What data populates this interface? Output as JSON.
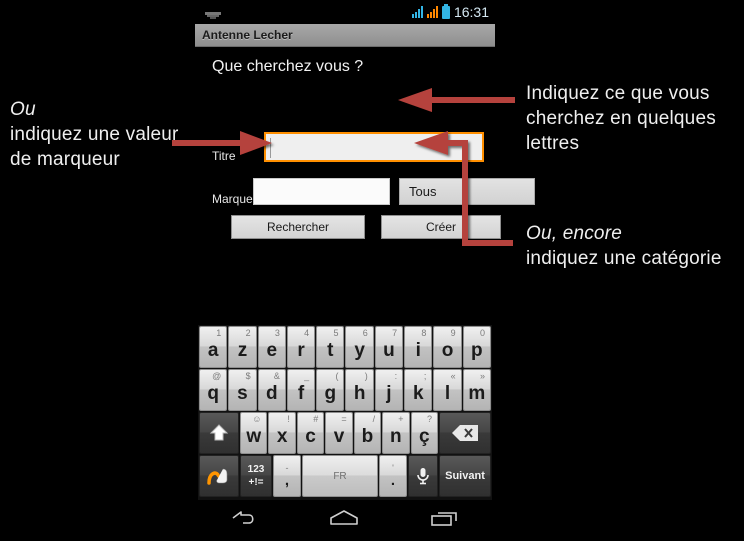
{
  "annotations": {
    "left": {
      "italic": "Ou",
      "rest": "indiquez une valeur de marqueur"
    },
    "top_right": {
      "text": "Indiquez ce que vous cherchez en quelques lettres"
    },
    "bottom_right": {
      "italic": "Ou, encore",
      "rest": "indiquez une catégorie"
    }
  },
  "statusbar": {
    "time": "16:31"
  },
  "titlebar": {
    "title": "Antenne Lecher"
  },
  "form": {
    "heading": "Que cherchez vous ?",
    "label_titre": "Titre",
    "value_titre": "",
    "label_marqueur": "Marqueur",
    "value_marqueur": "",
    "spinner_value": "Tous",
    "button_rechercher": "Rechercher",
    "button_creer": "Créer"
  },
  "keyboard": {
    "row1": [
      {
        "key": "a",
        "hint": "1"
      },
      {
        "key": "z",
        "hint": "2"
      },
      {
        "key": "e",
        "hint": "3"
      },
      {
        "key": "r",
        "hint": "4"
      },
      {
        "key": "t",
        "hint": "5"
      },
      {
        "key": "y",
        "hint": "6"
      },
      {
        "key": "u",
        "hint": "7"
      },
      {
        "key": "i",
        "hint": "8"
      },
      {
        "key": "o",
        "hint": "9"
      },
      {
        "key": "p",
        "hint": "0"
      }
    ],
    "row2": [
      {
        "key": "q",
        "hint": "@"
      },
      {
        "key": "s",
        "hint": "$"
      },
      {
        "key": "d",
        "hint": "&"
      },
      {
        "key": "f",
        "hint": "_"
      },
      {
        "key": "g",
        "hint": "("
      },
      {
        "key": "h",
        "hint": ")"
      },
      {
        "key": "j",
        "hint": ":"
      },
      {
        "key": "k",
        "hint": ";"
      },
      {
        "key": "l",
        "hint": "«"
      },
      {
        "key": "m",
        "hint": "»"
      }
    ],
    "row3": [
      {
        "key": "w",
        "hint": "☺"
      },
      {
        "key": "x",
        "hint": "!"
      },
      {
        "key": "c",
        "hint": "#"
      },
      {
        "key": "v",
        "hint": "="
      },
      {
        "key": "b",
        "hint": "/"
      },
      {
        "key": "n",
        "hint": "+"
      },
      {
        "key": "ç",
        "hint": "?"
      }
    ],
    "shift": "shift-icon",
    "backspace": "backspace-icon",
    "swipe": "swipe-gesture-icon",
    "numeric_top": "123",
    "numeric_bottom": "+!=",
    "comma_top": "-",
    "comma_bottom": ",",
    "space_label": "FR",
    "period_top": "'",
    "period_bottom": ".",
    "mic": "microphone-icon",
    "enter_label": "Suivant"
  },
  "navbar": {
    "back": "back-icon",
    "home": "home-icon",
    "recents": "recents-icon"
  },
  "colors": {
    "accent_orange": "#ff8f00",
    "arrow_red": "#b5433c",
    "status_blue": "#33b5e5"
  }
}
